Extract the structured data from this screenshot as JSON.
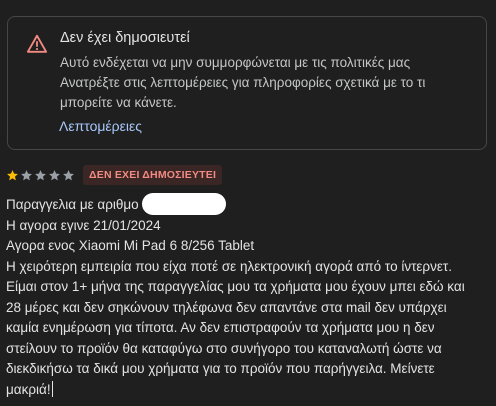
{
  "alert": {
    "icon": "warning-icon",
    "icon_color": "#f28b82",
    "title": "Δεν έχει δημοσιευτεί",
    "body_lines": [
      "Αυτό ενδέχεται να μην συμμορφώνεται με τις πολιτικές μας",
      "Ανατρέξτε στις λεπτομέρειες για πληροφορίες σχετικά με το τι",
      "μπορείτε να κάνετε."
    ],
    "details_link": "Λεπτομέρειες",
    "link_color": "#a8c7fa"
  },
  "review": {
    "rating": 1,
    "rating_max": 5,
    "star_filled_color": "#fbbc04",
    "star_empty_color": "#9aa0a6",
    "status_badge": "ΔΕΝ ΕΧΕΙ ΔΗΜΟΣΙΕΥΤΕΙ",
    "order_label": "Παραγγελια με αριθμο",
    "date_line": "Η αγορα εγινε 21/01/2024",
    "product_line": "Αγορα ενος Xiaomi Mi Pad 6 8/256 Tablet",
    "text_lines": [
      "Η χειρότερη εμπειρία που είχα ποτέ σε ηλεκτρονική αγορά από το ίντερνετ.",
      "Είμαι στον 1+ μήνα της παραγγελίας μου τα χρήματα μου έχουν μπει εδώ και",
      "28 μέρες και δεν σηκώνουν τηλέφωνα δεν απαντάνε στα mail δεν υπάρχει",
      "καμία ενημέρωση για τίποτα. Αν δεν επιστραφούν τα χρήματα μου η δεν",
      "στείλουν το προϊόν θα καταφύγω στο συνήγορο του καταναλωτή ώστε να",
      "διεκδικήσω τα δικά μου χρήματα για το προϊόν που παρήγγειλα. Μείνετε",
      "μακριά!"
    ]
  }
}
